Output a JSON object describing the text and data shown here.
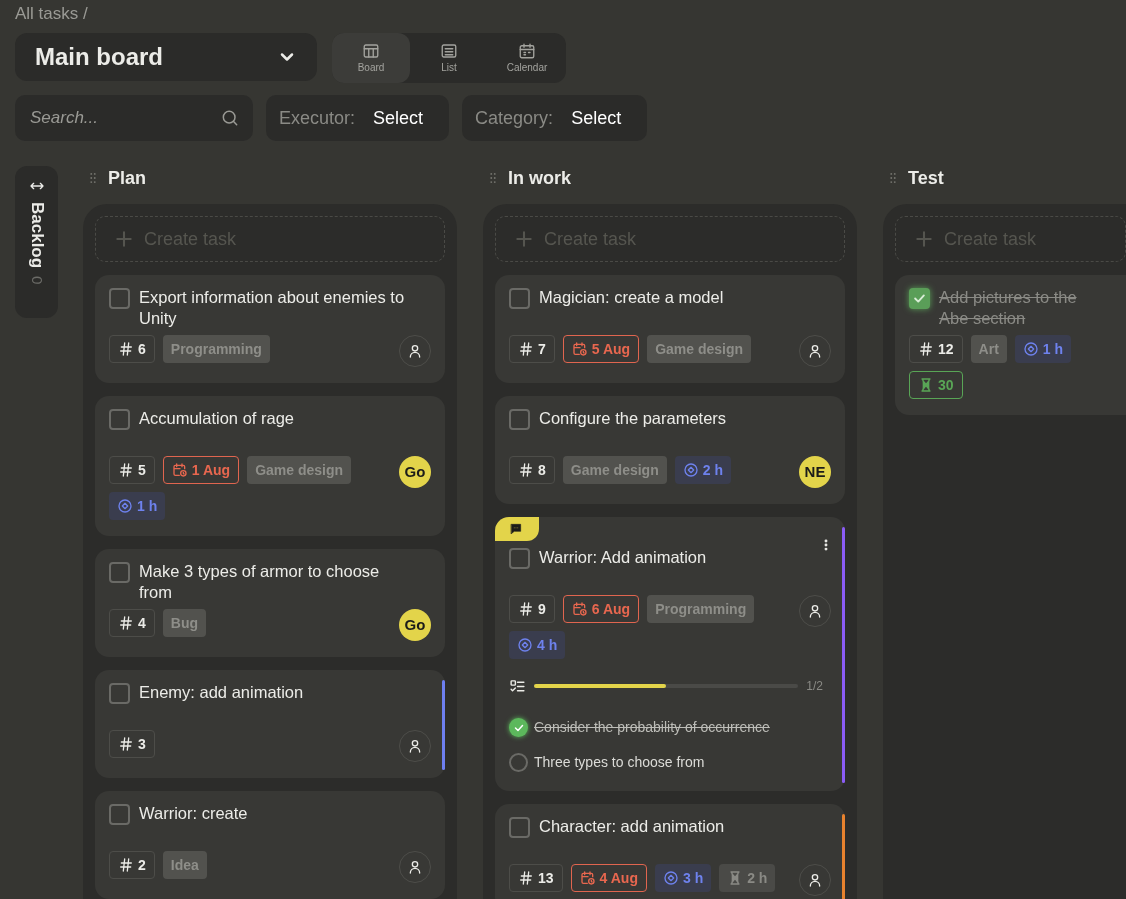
{
  "breadcrumb": "All tasks /",
  "board_selector": {
    "value": "Main board"
  },
  "views": [
    {
      "label": "Board",
      "kind": "board",
      "selected": true
    },
    {
      "label": "List",
      "kind": "list",
      "selected": false
    },
    {
      "label": "Calendar",
      "kind": "calendar",
      "selected": false
    }
  ],
  "search": {
    "placeholder": "Search..."
  },
  "filters": [
    {
      "label": "Executor:",
      "value": "Select"
    },
    {
      "label": "Category:",
      "value": "Select"
    }
  ],
  "backlog": {
    "label": "Backlog",
    "count": "0"
  },
  "columns": [
    {
      "title": "Plan",
      "create_label": "Create task",
      "cards": [
        {
          "title": "Export information about enemies to Unity",
          "checked": false,
          "number": "6",
          "category": "Programming",
          "assignee": {
            "kind": "none"
          }
        },
        {
          "title": "Accumulation of rage",
          "checked": false,
          "number": "5",
          "due": "1 Aug",
          "category": "Game design",
          "estimate": "1 h",
          "assignee": {
            "kind": "initials",
            "initials": "Go"
          }
        },
        {
          "title": "Make 3 types of armor to choose from",
          "checked": false,
          "number": "4",
          "category": "Bug",
          "assignee": {
            "kind": "initials",
            "initials": "Go"
          }
        },
        {
          "title": "Enemy: add animation",
          "checked": false,
          "number": "3",
          "color": "#6e7ff0",
          "assignee": {
            "kind": "none"
          }
        },
        {
          "title": "Warrior: create",
          "checked": false,
          "number": "2",
          "category": "Idea",
          "assignee": {
            "kind": "none"
          }
        }
      ]
    },
    {
      "title": "In work",
      "create_label": "Create task",
      "cards": [
        {
          "title": "Magician: create a model",
          "checked": false,
          "number": "7",
          "due": "5 Aug",
          "category": "Game design",
          "assignee": {
            "kind": "none"
          }
        },
        {
          "title": "Configure the parameters",
          "checked": false,
          "number": "8",
          "category": "Game design",
          "estimate": "2 h",
          "assignee": {
            "kind": "initials",
            "initials": "NE"
          }
        },
        {
          "title": "Warrior: Add animation",
          "checked": false,
          "number": "9",
          "due": "6 Aug",
          "category": "Programming",
          "estimate": "4 h",
          "color": "#8b5cf6",
          "comment": true,
          "menu": true,
          "assignee": {
            "kind": "none"
          },
          "checklist": {
            "progress": "1/2",
            "level": 0.5,
            "items": [
              {
                "text": "Consider the probability of occurrence",
                "checked": true
              },
              {
                "text": "Three types to choose from",
                "checked": false
              }
            ]
          }
        },
        {
          "title": "Character: add animation",
          "checked": false,
          "number": "13",
          "due": "4 Aug",
          "estimate": "3 h",
          "spent": {
            "text": "2 h",
            "kind": "normal"
          },
          "color": "#e8822e",
          "assignee": {
            "kind": "none"
          }
        }
      ]
    },
    {
      "title": "Test",
      "create_label": "Create task",
      "cards": [
        {
          "title": "Add pictures to the Abe section",
          "checked": true,
          "number": "12",
          "category": "Art",
          "estimate": "1 h",
          "spent": {
            "text": "30",
            "kind": "good"
          }
        }
      ]
    }
  ]
}
